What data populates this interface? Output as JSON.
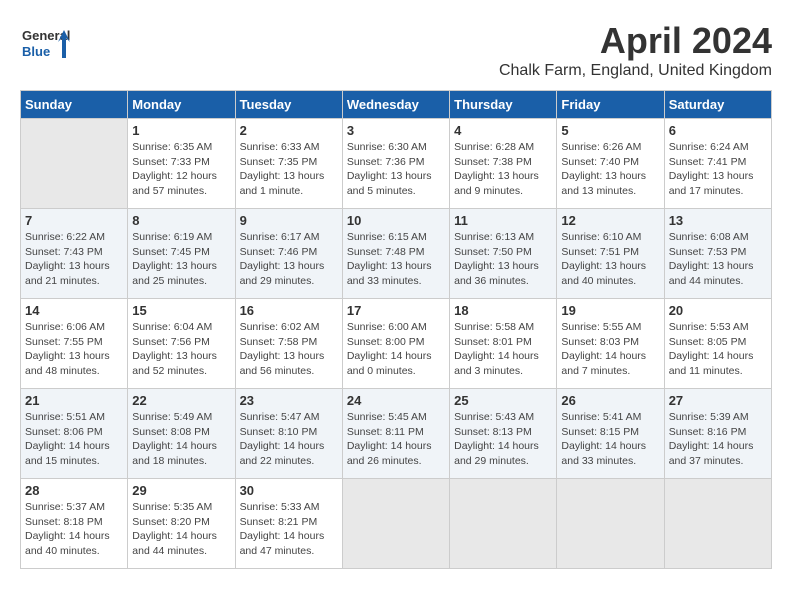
{
  "header": {
    "title": "April 2024",
    "subtitle": "Chalk Farm, England, United Kingdom",
    "logo_general": "General",
    "logo_blue": "Blue"
  },
  "days_of_week": [
    "Sunday",
    "Monday",
    "Tuesday",
    "Wednesday",
    "Thursday",
    "Friday",
    "Saturday"
  ],
  "weeks": [
    [
      {
        "day": "",
        "info": ""
      },
      {
        "day": "1",
        "info": "Sunrise: 6:35 AM\nSunset: 7:33 PM\nDaylight: 12 hours\nand 57 minutes."
      },
      {
        "day": "2",
        "info": "Sunrise: 6:33 AM\nSunset: 7:35 PM\nDaylight: 13 hours\nand 1 minute."
      },
      {
        "day": "3",
        "info": "Sunrise: 6:30 AM\nSunset: 7:36 PM\nDaylight: 13 hours\nand 5 minutes."
      },
      {
        "day": "4",
        "info": "Sunrise: 6:28 AM\nSunset: 7:38 PM\nDaylight: 13 hours\nand 9 minutes."
      },
      {
        "day": "5",
        "info": "Sunrise: 6:26 AM\nSunset: 7:40 PM\nDaylight: 13 hours\nand 13 minutes."
      },
      {
        "day": "6",
        "info": "Sunrise: 6:24 AM\nSunset: 7:41 PM\nDaylight: 13 hours\nand 17 minutes."
      }
    ],
    [
      {
        "day": "7",
        "info": "Sunrise: 6:22 AM\nSunset: 7:43 PM\nDaylight: 13 hours\nand 21 minutes."
      },
      {
        "day": "8",
        "info": "Sunrise: 6:19 AM\nSunset: 7:45 PM\nDaylight: 13 hours\nand 25 minutes."
      },
      {
        "day": "9",
        "info": "Sunrise: 6:17 AM\nSunset: 7:46 PM\nDaylight: 13 hours\nand 29 minutes."
      },
      {
        "day": "10",
        "info": "Sunrise: 6:15 AM\nSunset: 7:48 PM\nDaylight: 13 hours\nand 33 minutes."
      },
      {
        "day": "11",
        "info": "Sunrise: 6:13 AM\nSunset: 7:50 PM\nDaylight: 13 hours\nand 36 minutes."
      },
      {
        "day": "12",
        "info": "Sunrise: 6:10 AM\nSunset: 7:51 PM\nDaylight: 13 hours\nand 40 minutes."
      },
      {
        "day": "13",
        "info": "Sunrise: 6:08 AM\nSunset: 7:53 PM\nDaylight: 13 hours\nand 44 minutes."
      }
    ],
    [
      {
        "day": "14",
        "info": "Sunrise: 6:06 AM\nSunset: 7:55 PM\nDaylight: 13 hours\nand 48 minutes."
      },
      {
        "day": "15",
        "info": "Sunrise: 6:04 AM\nSunset: 7:56 PM\nDaylight: 13 hours\nand 52 minutes."
      },
      {
        "day": "16",
        "info": "Sunrise: 6:02 AM\nSunset: 7:58 PM\nDaylight: 13 hours\nand 56 minutes."
      },
      {
        "day": "17",
        "info": "Sunrise: 6:00 AM\nSunset: 8:00 PM\nDaylight: 14 hours\nand 0 minutes."
      },
      {
        "day": "18",
        "info": "Sunrise: 5:58 AM\nSunset: 8:01 PM\nDaylight: 14 hours\nand 3 minutes."
      },
      {
        "day": "19",
        "info": "Sunrise: 5:55 AM\nSunset: 8:03 PM\nDaylight: 14 hours\nand 7 minutes."
      },
      {
        "day": "20",
        "info": "Sunrise: 5:53 AM\nSunset: 8:05 PM\nDaylight: 14 hours\nand 11 minutes."
      }
    ],
    [
      {
        "day": "21",
        "info": "Sunrise: 5:51 AM\nSunset: 8:06 PM\nDaylight: 14 hours\nand 15 minutes."
      },
      {
        "day": "22",
        "info": "Sunrise: 5:49 AM\nSunset: 8:08 PM\nDaylight: 14 hours\nand 18 minutes."
      },
      {
        "day": "23",
        "info": "Sunrise: 5:47 AM\nSunset: 8:10 PM\nDaylight: 14 hours\nand 22 minutes."
      },
      {
        "day": "24",
        "info": "Sunrise: 5:45 AM\nSunset: 8:11 PM\nDaylight: 14 hours\nand 26 minutes."
      },
      {
        "day": "25",
        "info": "Sunrise: 5:43 AM\nSunset: 8:13 PM\nDaylight: 14 hours\nand 29 minutes."
      },
      {
        "day": "26",
        "info": "Sunrise: 5:41 AM\nSunset: 8:15 PM\nDaylight: 14 hours\nand 33 minutes."
      },
      {
        "day": "27",
        "info": "Sunrise: 5:39 AM\nSunset: 8:16 PM\nDaylight: 14 hours\nand 37 minutes."
      }
    ],
    [
      {
        "day": "28",
        "info": "Sunrise: 5:37 AM\nSunset: 8:18 PM\nDaylight: 14 hours\nand 40 minutes."
      },
      {
        "day": "29",
        "info": "Sunrise: 5:35 AM\nSunset: 8:20 PM\nDaylight: 14 hours\nand 44 minutes."
      },
      {
        "day": "30",
        "info": "Sunrise: 5:33 AM\nSunset: 8:21 PM\nDaylight: 14 hours\nand 47 minutes."
      },
      {
        "day": "",
        "info": ""
      },
      {
        "day": "",
        "info": ""
      },
      {
        "day": "",
        "info": ""
      },
      {
        "day": "",
        "info": ""
      }
    ]
  ]
}
